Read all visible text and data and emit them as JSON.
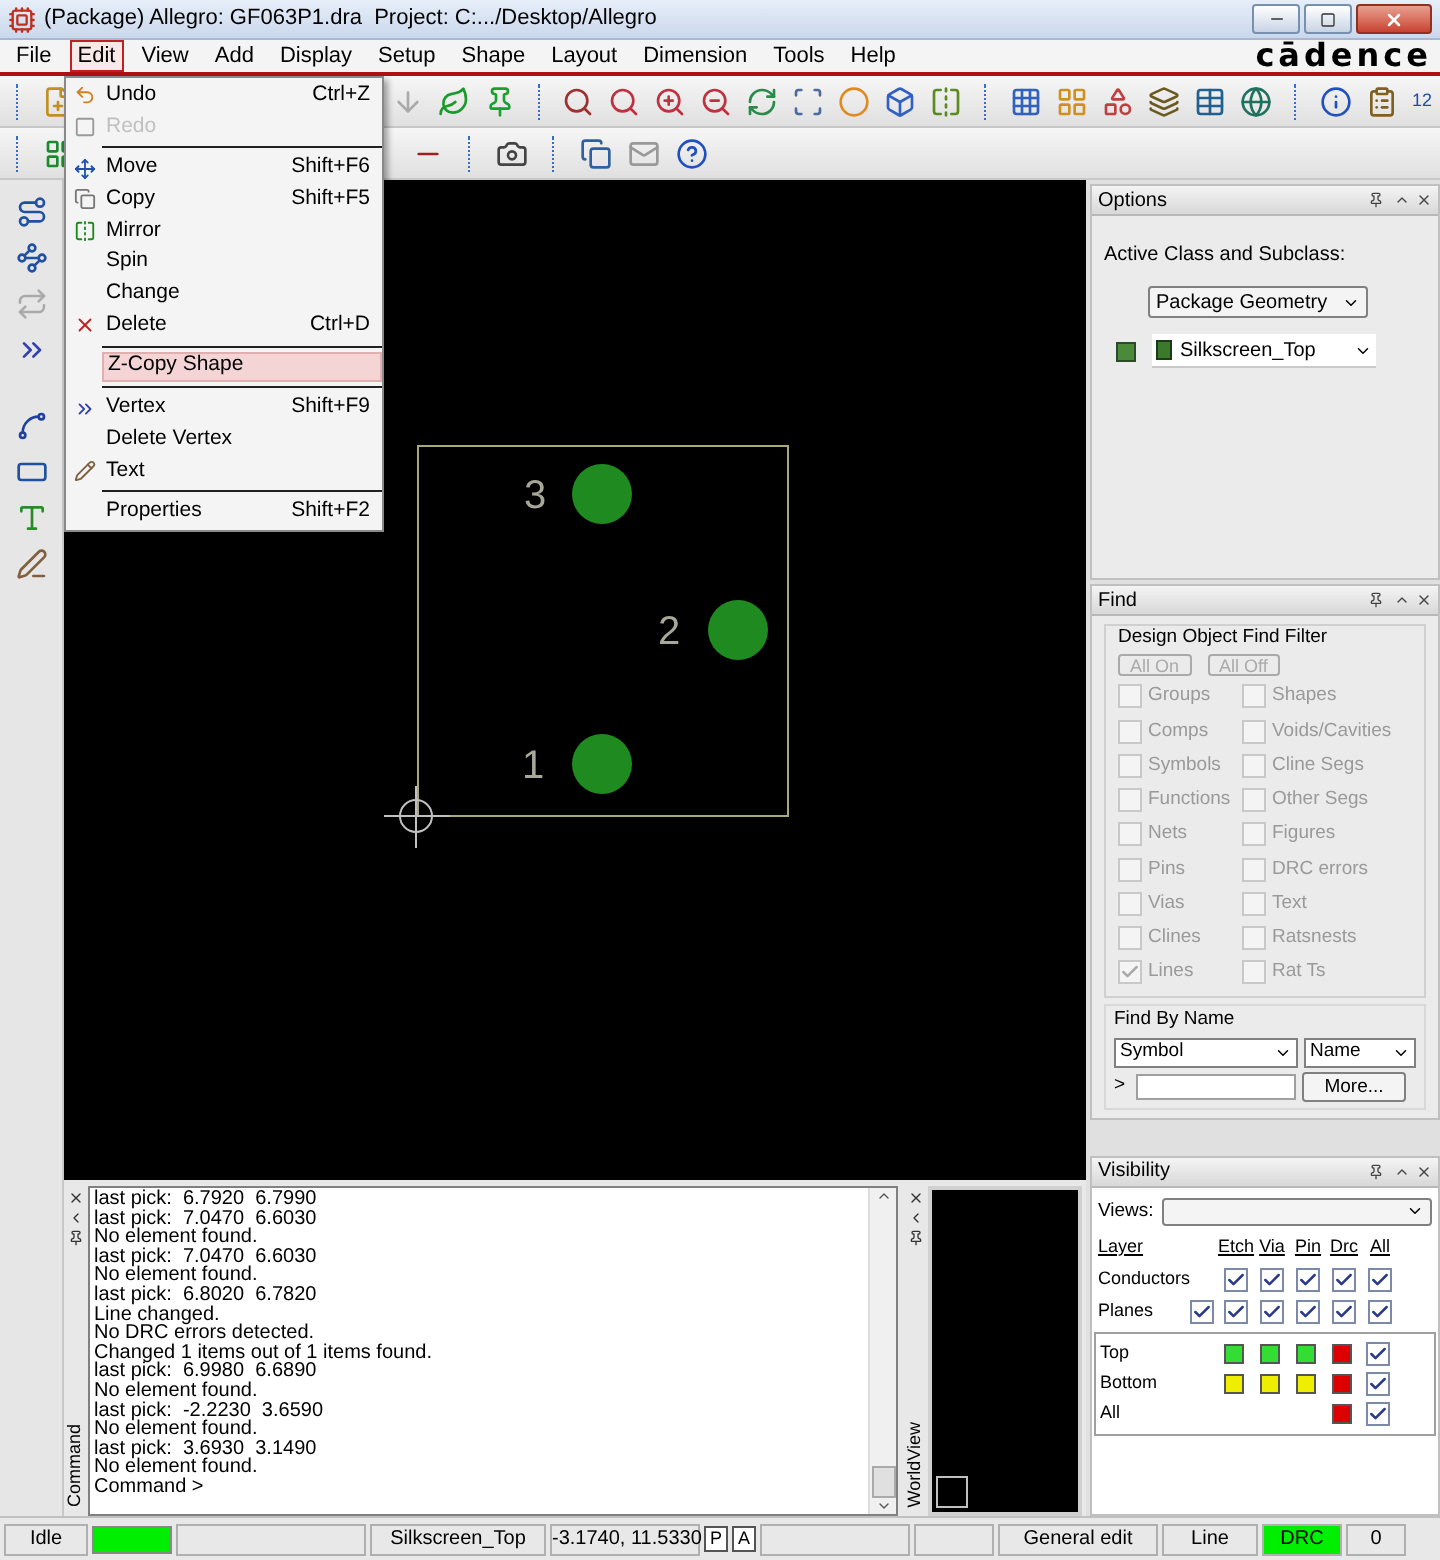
{
  "window": {
    "title": "(Package) Allegro: GF063P1.dra  Project: C:.../Desktop/Allegro"
  },
  "menu_bar": {
    "items": [
      {
        "label": "File",
        "selected": false
      },
      {
        "label": "Edit",
        "selected": true
      },
      {
        "label": "View",
        "selected": false
      },
      {
        "label": "Add",
        "selected": false
      },
      {
        "label": "Display",
        "selected": false
      },
      {
        "label": "Setup",
        "selected": false
      },
      {
        "label": "Shape",
        "selected": false
      },
      {
        "label": "Layout",
        "selected": false
      },
      {
        "label": "Dimension",
        "selected": false
      },
      {
        "label": "Tools",
        "selected": false
      },
      {
        "label": "Help",
        "selected": false
      }
    ],
    "logo": "cādence"
  },
  "toolbar": {
    "badge": "12"
  },
  "edit_menu": {
    "groups": [
      [
        {
          "label": "Undo",
          "shortcut": "Ctrl+Z",
          "disabled": false,
          "selected": false
        },
        {
          "label": "Redo",
          "disabled": true,
          "selected": false
        }
      ],
      [
        {
          "label": "Move",
          "shortcut": "Shift+F6",
          "disabled": false,
          "selected": false
        },
        {
          "label": "Copy",
          "shortcut": "Shift+F5",
          "disabled": false,
          "selected": false
        },
        {
          "label": "Mirror",
          "disabled": false,
          "selected": false
        },
        {
          "label": "Spin",
          "disabled": false,
          "selected": false
        },
        {
          "label": "Change",
          "disabled": false,
          "selected": false
        },
        {
          "label": "Delete",
          "shortcut": "Ctrl+D",
          "disabled": false,
          "selected": false
        }
      ],
      [
        {
          "label": "Z-Copy Shape",
          "disabled": false,
          "selected": true
        }
      ],
      [
        {
          "label": "Vertex",
          "shortcut": "Shift+F9",
          "disabled": false,
          "selected": false
        },
        {
          "label": "Delete Vertex",
          "disabled": false,
          "selected": false
        },
        {
          "label": "Text",
          "disabled": false,
          "selected": false
        }
      ],
      [
        {
          "label": "Properties",
          "shortcut": "Shift+F2",
          "disabled": false,
          "selected": false
        }
      ]
    ]
  },
  "canvas": {
    "pins": [
      {
        "label": "3"
      },
      {
        "label": "2"
      },
      {
        "label": "1"
      }
    ]
  },
  "options": {
    "title": "Options",
    "prompt": "Active Class and Subclass:",
    "class": "Package Geometry",
    "subclass": "Silkscreen_Top"
  },
  "find": {
    "title": "Find",
    "group": "Design Object Find Filter",
    "disabled": true,
    "buttons": [
      "All On",
      "All Off"
    ],
    "filters": [
      {
        "label": "Groups",
        "checked": false
      },
      {
        "label": "Shapes",
        "checked": false
      },
      {
        "label": "Comps",
        "checked": false
      },
      {
        "label": "Voids/Cavities",
        "checked": false
      },
      {
        "label": "Symbols",
        "checked": false
      },
      {
        "label": "Cline Segs",
        "checked": false
      },
      {
        "label": "Functions",
        "checked": false
      },
      {
        "label": "Other Segs",
        "checked": false
      },
      {
        "label": "Nets",
        "checked": false
      },
      {
        "label": "Figures",
        "checked": false
      },
      {
        "label": "Pins",
        "checked": false
      },
      {
        "label": "DRC errors",
        "checked": false
      },
      {
        "label": "Vias",
        "checked": false
      },
      {
        "label": "Text",
        "checked": false
      },
      {
        "label": "Clines",
        "checked": false
      },
      {
        "label": "Ratsnests",
        "checked": false
      },
      {
        "label": "Lines",
        "checked": true
      },
      {
        "label": "Rat Ts",
        "checked": false
      }
    ],
    "by_name": {
      "title": "Find By Name",
      "type": "Symbol",
      "field": "Name",
      "prompt": ">",
      "button": "More..."
    }
  },
  "visibility": {
    "title": "Visibility",
    "views_label": "Views:",
    "layer_label": "Layer",
    "columns": [
      "Etch",
      "Via",
      "Pin",
      "Drc",
      "All"
    ],
    "groups": [
      {
        "label": "Conductors",
        "checks": [
          true,
          true,
          true,
          true,
          true
        ]
      },
      {
        "label": "Planes",
        "own_check": true,
        "checks": [
          true,
          true,
          true,
          true,
          true
        ]
      }
    ],
    "layers": [
      {
        "label": "Top",
        "cells": [
          {
            "kind": "color",
            "color": "#33dd33"
          },
          {
            "kind": "color",
            "color": "#33dd33"
          },
          {
            "kind": "color",
            "color": "#33dd33"
          },
          {
            "kind": "color",
            "color": "#dd0000"
          },
          {
            "kind": "check",
            "checked": true
          }
        ]
      },
      {
        "label": "Bottom",
        "cells": [
          {
            "kind": "color",
            "color": "#eeee00"
          },
          {
            "kind": "color",
            "color": "#eeee00"
          },
          {
            "kind": "color",
            "color": "#eeee00"
          },
          {
            "kind": "color",
            "color": "#dd0000"
          },
          {
            "kind": "check",
            "checked": true
          }
        ]
      },
      {
        "label": "All",
        "cells": [
          null,
          null,
          null,
          {
            "kind": "color",
            "color": "#dd0000"
          },
          {
            "kind": "check",
            "checked": true
          }
        ]
      }
    ]
  },
  "command": {
    "title": "Command",
    "lines": [
      "last pick:  6.7920  6.7990",
      "last pick:  7.0470  6.6030",
      "No element found.",
      "last pick:  7.0470  6.6030",
      "No element found.",
      "last pick:  6.8020  6.7820",
      "Line changed.",
      "No DRC errors detected.",
      "Changed 1 items out of 1 items found.",
      "last pick:  6.9980  6.6890",
      "No element found.",
      "last pick:  -2.2230  3.6590",
      "No element found.",
      "last pick:  3.6930  3.1490",
      "No element found.",
      "Command >"
    ]
  },
  "worldview": {
    "title": "WorldView"
  },
  "status_bar": {
    "cells": [
      {
        "kind": "text",
        "text": "Idle"
      },
      {
        "kind": "indicator",
        "color": "#00ee00"
      },
      {
        "kind": "blank"
      },
      {
        "kind": "text",
        "text": "Silkscreen_Top"
      },
      {
        "kind": "text",
        "text": "-3.1740, 11.5330"
      },
      {
        "kind": "toggle",
        "text": "P"
      },
      {
        "kind": "toggle",
        "text": "A"
      },
      {
        "kind": "blank"
      },
      {
        "kind": "blank"
      },
      {
        "kind": "text",
        "text": "General edit"
      },
      {
        "kind": "text",
        "text": "Line"
      },
      {
        "kind": "text",
        "text": "DRC",
        "color": "#00ee00"
      },
      {
        "kind": "text",
        "text": "0"
      }
    ]
  }
}
